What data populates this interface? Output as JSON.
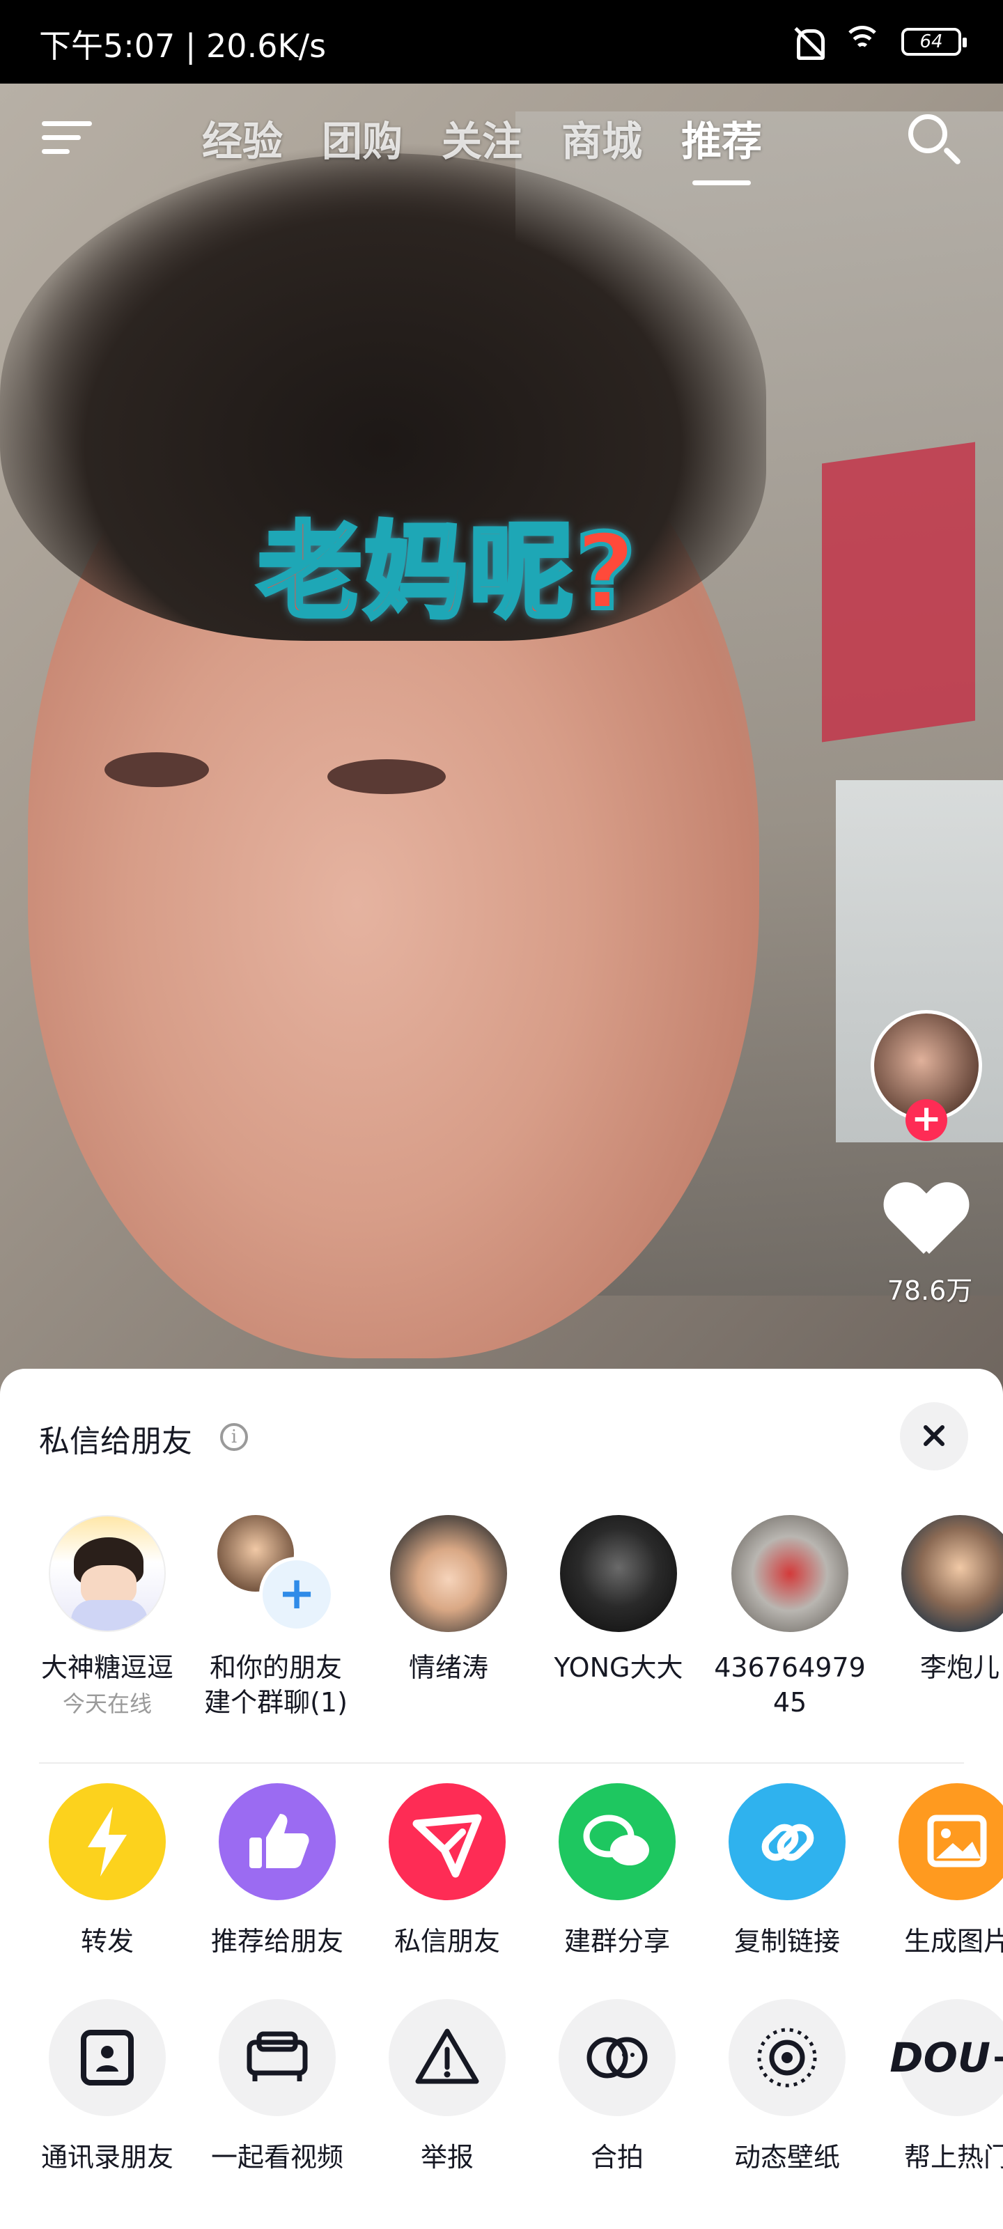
{
  "status_bar": {
    "time_speed": "下午5:07 | 20.6K/s",
    "battery": "64"
  },
  "top_nav": {
    "tabs": [
      {
        "label": "经验"
      },
      {
        "label": "团购"
      },
      {
        "label": "关注"
      },
      {
        "label": "商城"
      },
      {
        "label": "推荐",
        "active": true
      }
    ]
  },
  "video": {
    "caption": "老妈呢?",
    "like_count": "78.6万"
  },
  "share_sheet": {
    "title": "私信给朋友",
    "friends": [
      {
        "name": "大神糖逗逗",
        "sub": "今天在线"
      },
      {
        "name": "和你的朋友\n建个群聊(1)",
        "sub": ""
      },
      {
        "name": "情绪涛",
        "sub": ""
      },
      {
        "name": "YONG大大",
        "sub": ""
      },
      {
        "name": "43676497945",
        "sub": ""
      },
      {
        "name": "李炮儿",
        "sub": ""
      }
    ],
    "actions_row1": [
      {
        "label": "转发",
        "icon": "lightning-icon",
        "color": "#fcd21d"
      },
      {
        "label": "推荐给朋友",
        "icon": "thumbs-up-icon",
        "color": "#9b6bf2"
      },
      {
        "label": "私信朋友",
        "icon": "send-icon",
        "color": "#fe2c55"
      },
      {
        "label": "建群分享",
        "icon": "wechat-icon",
        "color": "#1ec760"
      },
      {
        "label": "复制链接",
        "icon": "link-icon",
        "color": "#2fb2ee"
      },
      {
        "label": "生成图片",
        "icon": "image-icon",
        "color": "#ff9a1f"
      }
    ],
    "actions_row2": [
      {
        "label": "通讯录朋友",
        "icon": "contacts-icon"
      },
      {
        "label": "一起看视频",
        "icon": "sofa-icon"
      },
      {
        "label": "举报",
        "icon": "warning-icon"
      },
      {
        "label": "合拍",
        "icon": "duet-icon"
      },
      {
        "label": "动态壁纸",
        "icon": "wallpaper-icon"
      },
      {
        "label": "帮上热门",
        "icon": "dou-plus-icon"
      }
    ]
  }
}
